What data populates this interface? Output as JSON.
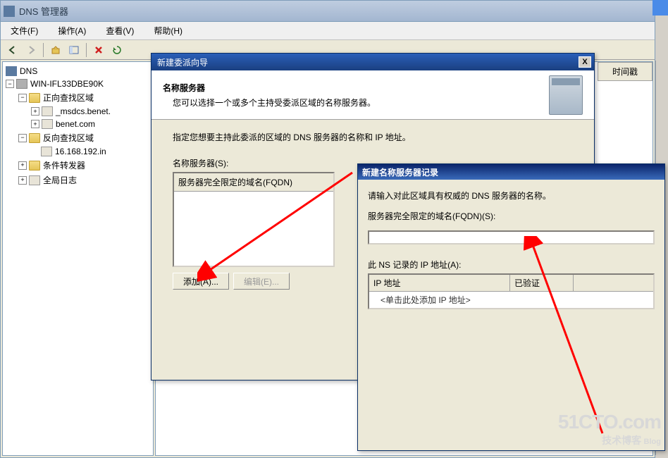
{
  "mainWindow": {
    "title": "DNS 管理器"
  },
  "menubar": {
    "file": "文件(F)",
    "action": "操作(A)",
    "view": "查看(V)",
    "help": "帮助(H)"
  },
  "tree": {
    "root": "DNS",
    "server": "WIN-IFL33DBE90K",
    "fwdLookup": "正向查找区域",
    "fwdZone1": "_msdcs.benet.",
    "fwdZone2": "benet.com",
    "revLookup": "反向查找区域",
    "revZone1": "16.168.192.in",
    "condFwd": "条件转发器",
    "globalLog": "全局日志"
  },
  "rightPanel": {
    "colTime": "时间戳"
  },
  "wizard": {
    "title": "新建委派向导",
    "headerTitle": "名称服务器",
    "headerSub": "您可以选择一个或多个主持受委派区域的名称服务器。",
    "instruction": "指定您想要主持此委派的区域的 DNS 服务器的名称和 IP 地址。",
    "listLabel": "名称服务器(S):",
    "listHeader": "服务器完全限定的域名(FQDN)",
    "btnAdd": "添加(A)...",
    "btnEdit": "编辑(E)...",
    "closeX": "X"
  },
  "nsDialog": {
    "title": "新建名称服务器记录",
    "prompt": "请输入对此区域具有权威的 DNS 服务器的名称。",
    "fqdnLabel": "服务器完全限定的域名(FQDN)(S):",
    "ipLabel": "此 NS 记录的 IP 地址(A):",
    "ipCol": "IP 地址",
    "verifiedCol": "已验证",
    "ipPlaceholder": "<单击此处添加 IP 地址>"
  },
  "watermark": {
    "big": "51CTO.com",
    "small1": "技术博客",
    "small2": "Blog"
  }
}
